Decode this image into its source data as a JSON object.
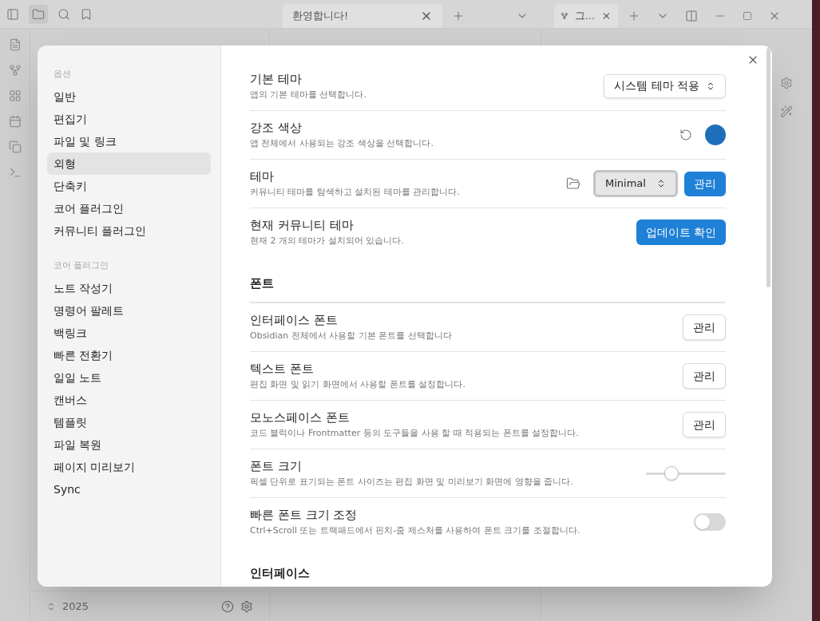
{
  "app": {
    "panes": [
      {
        "tab": "환영합니다!"
      },
      {
        "tab": "그..."
      }
    ],
    "vault_name": "2025"
  },
  "settings": {
    "sidebar": [
      {
        "heading": "옵션",
        "items": [
          {
            "label": "일반",
            "selected": false
          },
          {
            "label": "편집기",
            "selected": false
          },
          {
            "label": "파일 및 링크",
            "selected": false
          },
          {
            "label": "외형",
            "selected": true
          },
          {
            "label": "단축키",
            "selected": false
          },
          {
            "label": "코어 플러그인",
            "selected": false
          },
          {
            "label": "커뮤니티 플러그인",
            "selected": false
          }
        ]
      },
      {
        "heading": "코어 플러그인",
        "items": [
          {
            "label": "노트 작성기",
            "selected": false
          },
          {
            "label": "명령어 팔레트",
            "selected": false
          },
          {
            "label": "백링크",
            "selected": false
          },
          {
            "label": "빠른 전환기",
            "selected": false
          },
          {
            "label": "일일 노트",
            "selected": false
          },
          {
            "label": "캔버스",
            "selected": false
          },
          {
            "label": "템플릿",
            "selected": false
          },
          {
            "label": "파일 복원",
            "selected": false
          },
          {
            "label": "페이지 미리보기",
            "selected": false
          },
          {
            "label": "Sync",
            "selected": false
          }
        ]
      }
    ],
    "sections": [
      {
        "rows": [
          {
            "kind": "dropdown",
            "name": "기본 테마",
            "description": "앱의 기본 테마를 선택합니다.",
            "value": "시스템 테마 적용"
          },
          {
            "kind": "color",
            "name": "강조 색상",
            "description": "앱 전체에서 사용되는 강조 색상을 선택합니다.",
            "color": "#1e6fba"
          },
          {
            "kind": "theme",
            "name": "테마",
            "description": "커뮤니티 테마를 탐색하고 설치된 테마를 관리합니다.",
            "value": "Minimal",
            "button": "관리"
          },
          {
            "kind": "button",
            "name": "현재 커뮤니티 테마",
            "description": "현재 2 개의 테마가 설치되어 있습니다.",
            "button": "업데이트 확인",
            "primary": true
          }
        ]
      },
      {
        "heading": "폰트",
        "rows": [
          {
            "kind": "button",
            "name": "인터페이스 폰트",
            "description": "Obsidian 전체에서 사용할 기본 폰트를 선택합니다",
            "button": "관리",
            "primary": false
          },
          {
            "kind": "button",
            "name": "텍스트 폰트",
            "description": "편집 화면 및 읽기 화면에서 사용할 폰트를 설정합니다.",
            "button": "관리",
            "primary": false
          },
          {
            "kind": "button",
            "name": "모노스페이스 폰트",
            "description": "코드 블럭이나 Frontmatter 등의 도구들을 사용 할 때 적용되는 폰트를 설정합니다.",
            "button": "관리",
            "primary": false
          },
          {
            "kind": "slider",
            "name": "폰트 크기",
            "description": "픽셀 단위로 표기되는 폰트 사이즈는 편집 화면 및 미리보기 화면에 영향을 줍니다.",
            "level": 0.32
          },
          {
            "kind": "toggle",
            "name": "빠른 폰트 크기 조정",
            "description": "Ctrl+Scroll 또는 트랙패드에서 핀치-줌 제스처를 사용하여 폰트 크기를 조절합니다.",
            "on": false
          }
        ]
      },
      {
        "heading": "인터페이스"
      }
    ]
  }
}
